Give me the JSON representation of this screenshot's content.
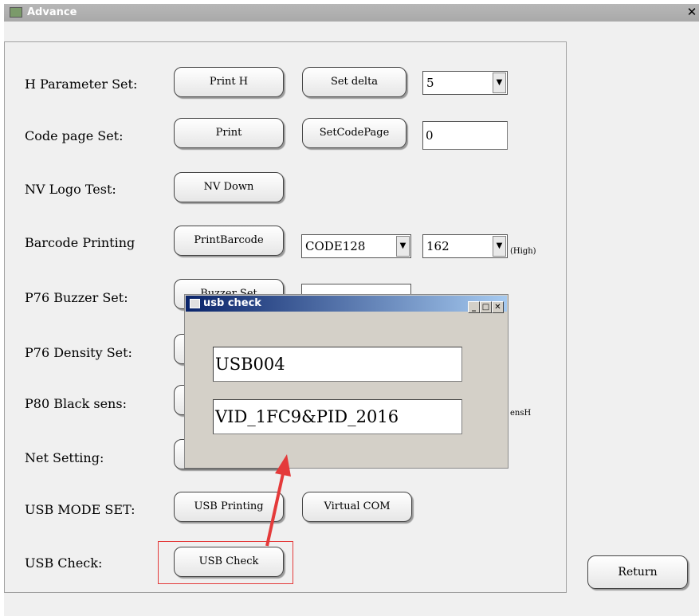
{
  "window": {
    "title": "Advance",
    "close_glyph": "✕"
  },
  "rows": {
    "h_param": {
      "label": "H Parameter Set:",
      "btn1": "Print H",
      "btn2": "Set delta",
      "combo_value": "5"
    },
    "code_page": {
      "label": "Code page Set:",
      "btn1": "Print",
      "btn2": "SetCodePage",
      "field_value": "0"
    },
    "nv_logo": {
      "label": "NV Logo Test:",
      "btn1": "NV Down"
    },
    "barcode": {
      "label": "Barcode Printing",
      "btn1": "PrintBarcode",
      "combo1_value": "CODE128",
      "combo2_value": "162",
      "high_label": "(High)"
    },
    "buzzer": {
      "label": "P76 Buzzer Set:",
      "btn1_partial": "Buzzer Set"
    },
    "density": {
      "label": "P76 Density Set:"
    },
    "black_sens": {
      "label": "P80 Black sens:",
      "right_partial": "ensH"
    },
    "net": {
      "label": "Net Setting:"
    },
    "usb_mode": {
      "label": "USB MODE SET:",
      "btn1": "USB Printing",
      "btn2": "Virtual COM"
    },
    "usb_check": {
      "label": "USB Check:",
      "btn1": "USB Check"
    }
  },
  "return_button": "Return",
  "dialog": {
    "title": "usb check",
    "field1": "USB004",
    "field2": "VID_1FC9&PID_2016"
  },
  "icons": {
    "window_icon": "app-icon",
    "dialog_icon": "window-icon",
    "dropdown": "▼",
    "minimize": "_",
    "maximize": "□",
    "close": "✕"
  },
  "colors": {
    "annotation": "#e43a3a",
    "dialog_title_start": "#0a246a"
  }
}
